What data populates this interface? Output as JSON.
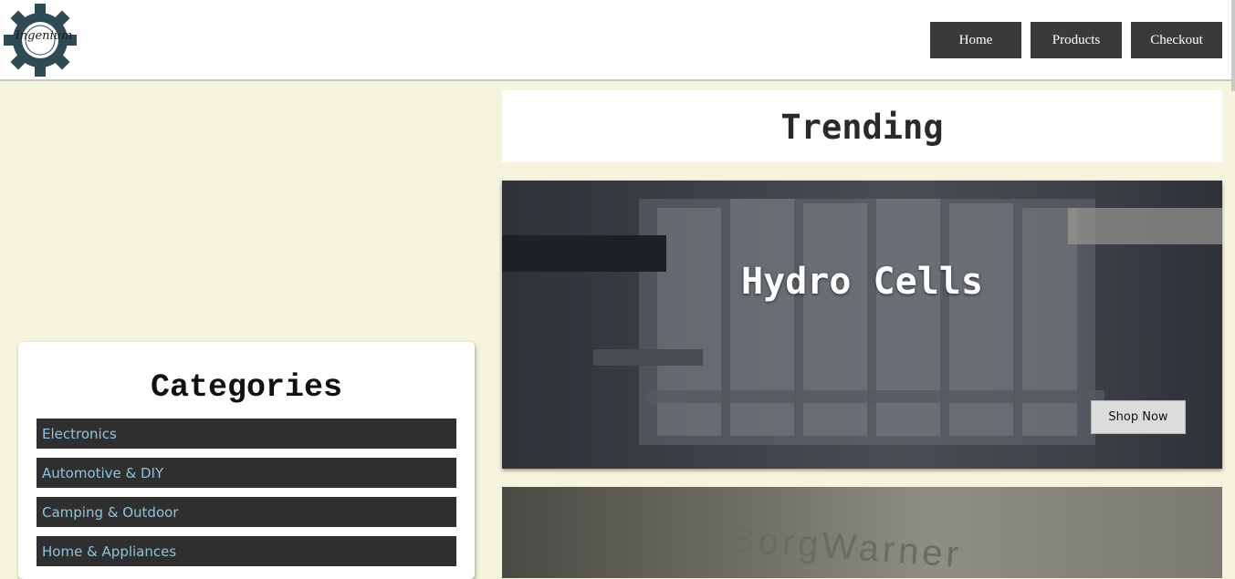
{
  "header": {
    "logo_text": "Ingenium",
    "nav": [
      {
        "label": "Home"
      },
      {
        "label": "Products"
      },
      {
        "label": "Checkout"
      }
    ]
  },
  "categories": {
    "title": "Categories",
    "items": [
      {
        "label": "Electronics"
      },
      {
        "label": "Automotive & DIY"
      },
      {
        "label": "Camping & Outdoor"
      },
      {
        "label": "Home & Appliances"
      }
    ]
  },
  "trending": {
    "title": "Trending",
    "cards": [
      {
        "title": "Hydro Cells",
        "button_label": "Shop Now"
      },
      {
        "image_text": "BorgWarner"
      }
    ]
  },
  "colors": {
    "page_bg": "#f5f4dc",
    "nav_button": "#3a3a3a",
    "category_item_bg": "#2f2f2f",
    "category_link": "#8cc4dc"
  }
}
